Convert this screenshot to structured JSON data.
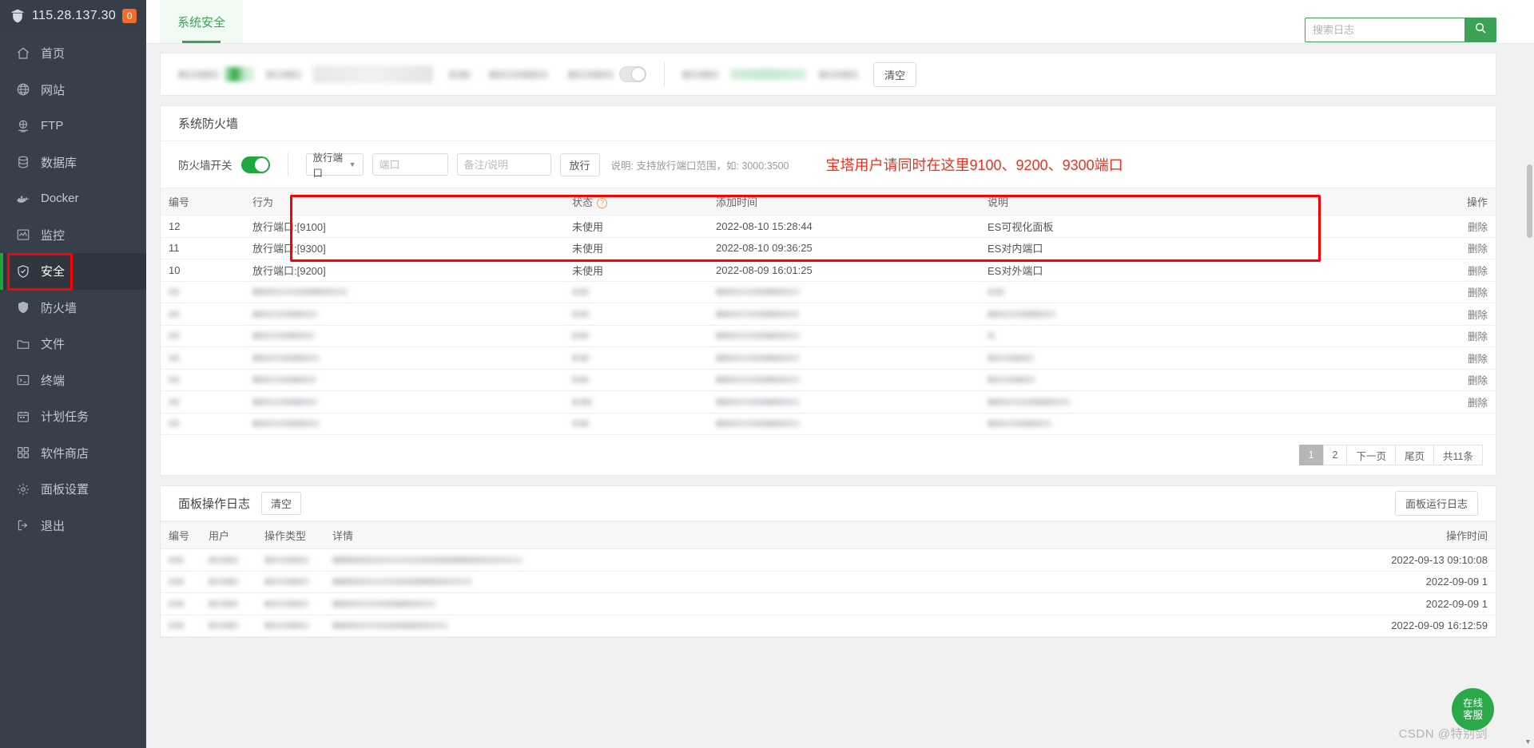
{
  "sidebar": {
    "ip": "115.28.137.30",
    "badge": "0",
    "items": [
      {
        "label": "首页",
        "icon": "home-icon"
      },
      {
        "label": "网站",
        "icon": "globe-icon"
      },
      {
        "label": "FTP",
        "icon": "ftp-icon"
      },
      {
        "label": "数据库",
        "icon": "database-icon"
      },
      {
        "label": "Docker",
        "icon": "docker-icon"
      },
      {
        "label": "监控",
        "icon": "monitor-icon"
      },
      {
        "label": "安全",
        "icon": "shield-check-icon"
      },
      {
        "label": "防火墙",
        "icon": "shield-icon"
      },
      {
        "label": "文件",
        "icon": "folder-icon"
      },
      {
        "label": "终端",
        "icon": "terminal-icon"
      },
      {
        "label": "计划任务",
        "icon": "calendar-icon"
      },
      {
        "label": "软件商店",
        "icon": "grid-icon"
      },
      {
        "label": "面板设置",
        "icon": "gear-icon"
      },
      {
        "label": "退出",
        "icon": "logout-icon"
      }
    ],
    "active_index": 6
  },
  "topbar": {
    "tabs": [
      {
        "label": "系统安全",
        "active": true
      }
    ],
    "search_placeholder": "搜索日志",
    "search_value": "",
    "search_icon": "search-icon"
  },
  "filterbar": {
    "clear_label": "清空"
  },
  "firewall": {
    "title": "系统防火墙",
    "switch_label": "防火墙开关",
    "switch_on": true,
    "type_select": "放行端口",
    "port_placeholder": "端口",
    "note_placeholder": "备注/说明",
    "submit_label": "放行",
    "hint": "说明: 支持放行端口范围，如: 3000:3500",
    "annotation": "宝塔用户请同时在这里9100、9200、9300端口",
    "annotation_color": "#ff2a15",
    "columns": [
      "编号",
      "行为",
      "状态",
      "添加时间",
      "说明",
      "操作"
    ],
    "status_help_icon": "question-icon",
    "rows": [
      {
        "id": "12",
        "action": "放行端口:[9100]",
        "status": "未使用",
        "time": "2022-08-10 15:28:44",
        "desc": "ES可视化面板",
        "op": "删除",
        "highlight": true
      },
      {
        "id": "11",
        "action": "放行端口:[9300]",
        "status": "未使用",
        "time": "2022-08-10 09:36:25",
        "desc": "ES对内端口",
        "op": "删除",
        "highlight": true
      },
      {
        "id": "10",
        "action": "放行端口:[9200]",
        "status": "未使用",
        "time": "2022-08-09 16:01:25",
        "desc": "ES对外端口",
        "op": "删除",
        "highlight": true
      },
      {
        "id": "",
        "action": "",
        "status": "",
        "time": "",
        "desc": "",
        "op": "删除",
        "highlight": false
      },
      {
        "id": "",
        "action": "",
        "status": "",
        "time": "",
        "desc": "",
        "op": "删除",
        "highlight": false
      },
      {
        "id": "",
        "action": "",
        "status": "",
        "time": "",
        "desc": "",
        "op": "删除",
        "highlight": false
      },
      {
        "id": "",
        "action": "",
        "status": "",
        "time": "",
        "desc": "",
        "op": "删除",
        "highlight": false
      },
      {
        "id": "",
        "action": "",
        "status": "",
        "time": "",
        "desc": "",
        "op": "删除",
        "highlight": false
      },
      {
        "id": "",
        "action": "",
        "status": "",
        "time": "",
        "desc": "",
        "op": "删除",
        "highlight": false
      },
      {
        "id": "",
        "action": "",
        "status": "",
        "time": "",
        "desc": "",
        "op": "",
        "highlight": false
      }
    ],
    "pagination": {
      "pages": [
        "1",
        "2"
      ],
      "current": "1",
      "next_label": "下一页",
      "last_label": "尾页",
      "total_label": "共11条"
    }
  },
  "oplog": {
    "title": "面板操作日志",
    "clear_label": "清空",
    "runlog_label": "面板运行日志",
    "columns": [
      "编号",
      "用户",
      "操作类型",
      "详情",
      "操作时间"
    ],
    "rows": [
      {
        "time": "2022-09-13 09:10:08"
      },
      {
        "time": "2022-09-09 1"
      },
      {
        "time": "2022-09-09 1"
      },
      {
        "time": "2022-09-09 16:12:59"
      }
    ]
  },
  "fab": {
    "line1": "在线",
    "line2": "客服"
  },
  "watermark": "CSDN @特别剑",
  "colors": {
    "accent_green": "#3ca256",
    "sidebar_bg": "#373f4a",
    "annotation_red": "#ff0000",
    "badge_orange": "#ef6c29"
  }
}
